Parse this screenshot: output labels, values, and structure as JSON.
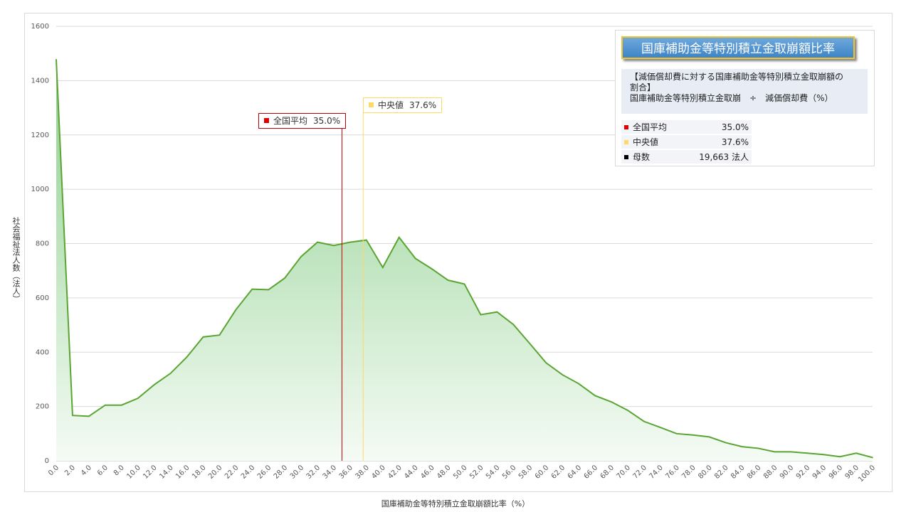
{
  "chart_data": {
    "type": "area",
    "title": "国庫補助金等特別積立金取崩額比率",
    "xlabel": "国庫補助金等特別積立金取崩額比率（%）",
    "ylabel": "社会福祉法人数（法人）",
    "ylim": [
      0,
      1600
    ],
    "yticks": [
      0,
      200,
      400,
      600,
      800,
      1000,
      1200,
      1400,
      1600
    ],
    "xlim": [
      0,
      100
    ],
    "xtick_labels": [
      "0.0",
      "2.0",
      "4.0",
      "6.0",
      "8.0",
      "10.0",
      "12.0",
      "14.0",
      "16.0",
      "18.0",
      "20.0",
      "22.0",
      "24.0",
      "26.0",
      "28.0",
      "30.0",
      "32.0",
      "34.0",
      "36.0",
      "38.0",
      "40.0",
      "42.0",
      "44.0",
      "46.0",
      "48.0",
      "50.0",
      "52.0",
      "54.0",
      "56.0",
      "58.0",
      "60.0",
      "62.0",
      "64.0",
      "66.0",
      "68.0",
      "70.0",
      "72.0",
      "74.0",
      "76.0",
      "78.0",
      "80.0",
      "82.0",
      "84.0",
      "86.0",
      "88.0",
      "90.0",
      "92.0",
      "94.0",
      "96.0",
      "98.0",
      "100.0"
    ],
    "x": [
      0,
      2,
      4,
      6,
      8,
      10,
      12,
      14,
      16,
      18,
      20,
      22,
      24,
      26,
      28,
      30,
      32,
      34,
      36,
      38,
      40,
      42,
      44,
      46,
      48,
      50,
      52,
      54,
      56,
      58,
      60,
      62,
      64,
      66,
      68,
      70,
      72,
      74,
      76,
      78,
      80,
      82,
      84,
      86,
      88,
      90,
      92,
      94,
      96,
      98,
      100
    ],
    "values": [
      1478,
      167,
      164,
      205,
      205,
      230,
      280,
      322,
      382,
      456,
      463,
      556,
      632,
      630,
      673,
      752,
      805,
      793,
      805,
      813,
      712,
      823,
      745,
      707,
      665,
      651,
      538,
      548,
      502,
      432,
      361,
      317,
      284,
      240,
      217,
      186,
      145,
      123,
      100,
      95,
      88,
      67,
      52,
      46,
      33,
      33,
      28,
      23,
      15,
      28,
      12
    ],
    "grid": true,
    "legend": "none",
    "colors": {
      "line": "#5aa532",
      "fill_top": "#8ccf8c",
      "fill_bottom": "#f5fbf5",
      "mean": "#c00000",
      "median": "#ffd966"
    },
    "annotations": {
      "mean": {
        "label": "全国平均",
        "value": 35.0,
        "value_label": "35.0%"
      },
      "median": {
        "label": "中央値",
        "value": 37.6,
        "value_label": "37.6%"
      }
    }
  },
  "panel": {
    "title": "国庫補助金等特別積立金取崩額比率",
    "desc_line1": "【減価償却費に対する国庫補助金等特別積立金取崩額の",
    "desc_line2": "割合】",
    "formula_numerator": "国庫補助金等特別積立金取崩",
    "formula_op": "÷",
    "formula_denominator": "減価償却費（%）",
    "stats": [
      {
        "label": "全国平均",
        "value": "35.0%",
        "color": "#e00000"
      },
      {
        "label": "中央値",
        "value": "37.6%",
        "color": "#ffd966"
      },
      {
        "label": "母数",
        "value": "19,663  法人",
        "color": "#000000"
      }
    ]
  }
}
